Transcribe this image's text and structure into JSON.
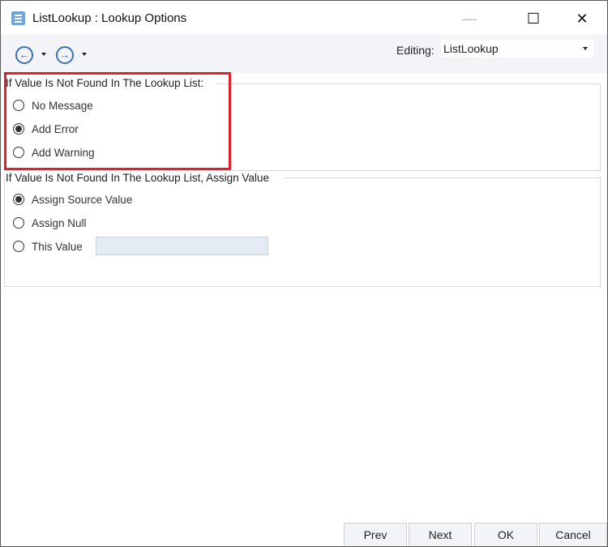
{
  "window": {
    "title": "ListLookup : Lookup Options",
    "minimize": "—",
    "maximize": "☐",
    "close": "✕"
  },
  "toolbar": {
    "back": "←",
    "forward": "→",
    "editing_label": "Editing:",
    "editing_value": "ListLookup"
  },
  "group1": {
    "label": "If Value Is Not Found In The Lookup List:",
    "options": [
      {
        "label": "No Message",
        "checked": false
      },
      {
        "label": "Add Error",
        "checked": true
      },
      {
        "label": "Add Warning",
        "checked": false
      }
    ]
  },
  "group2": {
    "label": "If Value Is Not Found In The Lookup List, Assign Value",
    "options": [
      {
        "label": "Assign Source Value",
        "checked": true
      },
      {
        "label": "Assign Null",
        "checked": false
      },
      {
        "label": "This Value",
        "checked": false
      }
    ],
    "this_value": ""
  },
  "buttons": {
    "prev": "Prev",
    "next": "Next",
    "ok": "OK",
    "cancel": "Cancel"
  }
}
